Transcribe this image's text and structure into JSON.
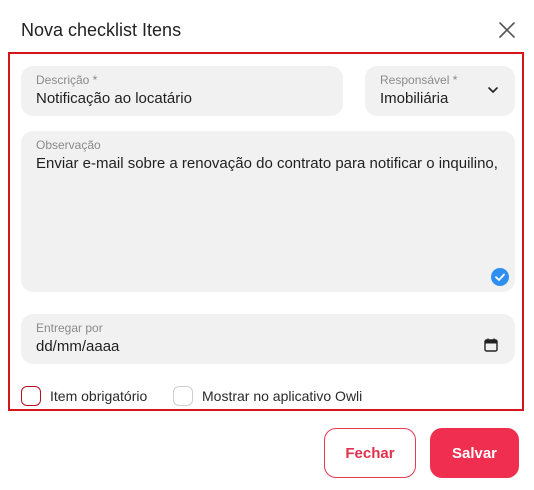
{
  "dialog": {
    "title": "Nova checklist Itens"
  },
  "form": {
    "descricao": {
      "label": "Descrição *",
      "value": "Notificação ao locatário"
    },
    "responsavel": {
      "label": "Responsável *",
      "value": "Imobiliária"
    },
    "observacao": {
      "label": "Observação",
      "value": "Enviar e-mail sobre a renovação do contrato para notificar o inquilino,"
    },
    "entregar_por": {
      "label": "Entregar por",
      "value": "dd/mm/aaaa"
    },
    "item_obrigatorio": {
      "label": "Item obrigatório",
      "checked": false
    },
    "mostrar_aplicativo": {
      "label": "Mostrar no aplicativo Owli",
      "checked": false
    }
  },
  "buttons": {
    "close_label": "Fechar",
    "save_label": "Salvar"
  },
  "colors": {
    "accent": "#f02e4f",
    "frame": "#d7141a",
    "badge": "#2f8ff0"
  },
  "icons": {
    "close": "close-icon",
    "dropdown": "chevron-down-icon",
    "validated": "check-circle-icon",
    "calendar": "calendar-icon"
  }
}
